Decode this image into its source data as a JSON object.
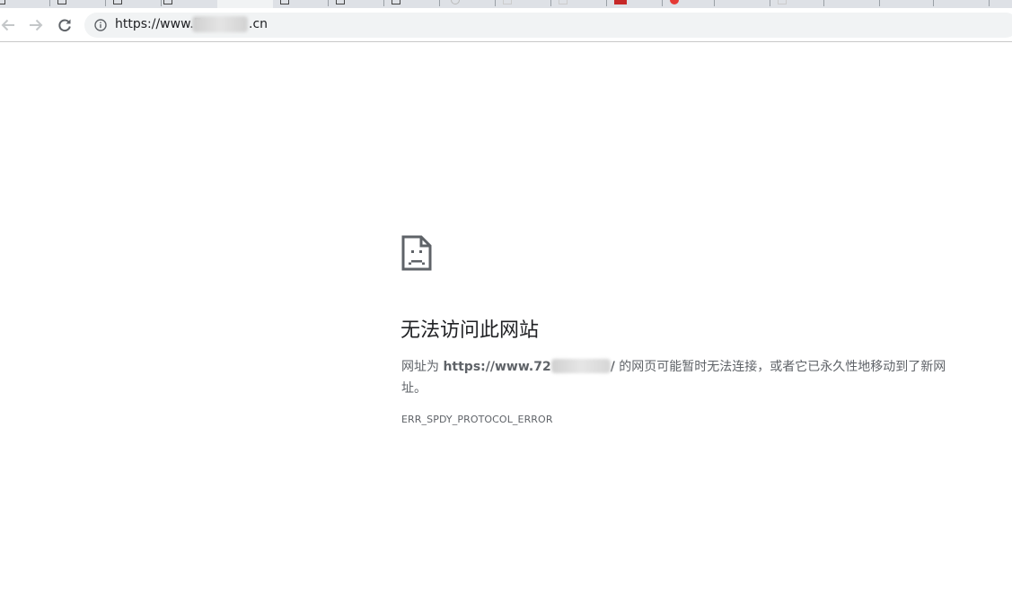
{
  "toolbar": {
    "url_prefix": "https://www.7",
    "url_suffix": ".cn",
    "icons": {
      "back": "arrow-left-icon",
      "forward": "arrow-right-icon",
      "reload": "reload-icon",
      "site_info": "info-icon"
    }
  },
  "error": {
    "title": "无法访问此网站",
    "desc_prefix": "网址为 ",
    "desc_url_prefix": "https://www.72",
    "desc_url_suffix": "/",
    "desc_rest": " 的网页可能暂时无法连接，或者它已永久性地移动到了新网址。",
    "code": "ERR_SPDY_PROTOCOL_ERROR",
    "icon": "sad-page-icon"
  },
  "colors": {
    "tabstrip": "#dee1e6",
    "omnibox": "#f1f3f4",
    "title": "#202124",
    "body_text": "#5f6368"
  }
}
